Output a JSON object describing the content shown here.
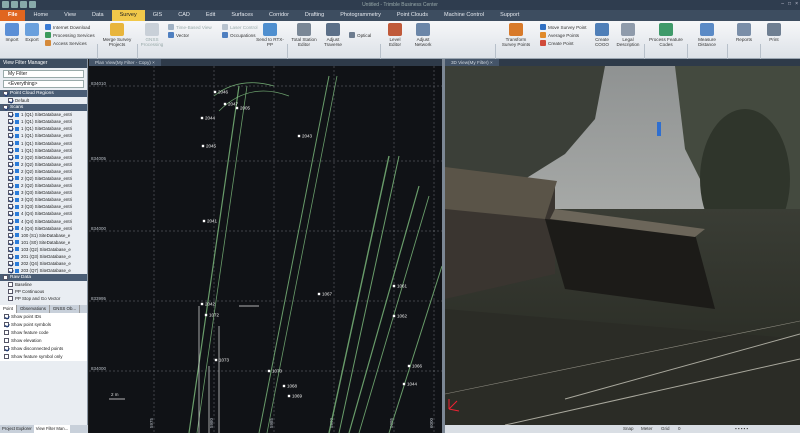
{
  "titlebar": {
    "window_title": "Untitled - Trimble Business Center"
  },
  "tabs": [
    "File",
    "Home",
    "View",
    "Data",
    "Survey",
    "GIS",
    "CAD",
    "Edit",
    "Surfaces",
    "Corridor",
    "Drafting",
    "Photogrammetry",
    "Point Clouds",
    "Machine Control",
    "Support"
  ],
  "active_tab": "Survey",
  "ribbon": {
    "import": "Import",
    "export": "Export",
    "internet_download": "Internet Download",
    "processing_services": "Processing Services",
    "access_services": "Access Services",
    "merge_survey_projects": "Merge Survey Projects",
    "gnss_processing": "GNSS Processing",
    "time_based_view": "Time-Based View",
    "vector": "Vector",
    "occupations": "Occupations",
    "laser_control": "Laser Control",
    "send_to": "Send to RTX-PP",
    "total_station_editor": "Total Station Editor",
    "adjust_traverse": "Adjust Traverse",
    "optical": "Optical",
    "level_editor": "Level Editor",
    "adjust_network": "Adjust Network",
    "transform_survey_points": "Transform Survey Points",
    "move_survey_point": "Move Survey Point",
    "average_points": "Average Points",
    "create_point": "Create Point",
    "create_cogo": "Create COGO",
    "legal_description": "Legal Description",
    "process_feature_codes": "Process Feature Codes",
    "measure_distance": "Measure Distance",
    "reports": "Reports",
    "print": "Print",
    "groups": {
      "import": "Import Export",
      "gnss": "GNSS",
      "optical": "Optical",
      "cogo": "COGO",
      "feature": "Feature",
      "measure": "Measure",
      "reports": "Reports",
      "print": "Print"
    }
  },
  "sidebar": {
    "title": "View Filter Manager",
    "filter_name": "My Filter",
    "everything": "<Everything>",
    "sections": {
      "point_cloud_regions": "Point Cloud Regions",
      "scans": "Scans",
      "raw_data": "Raw Data"
    },
    "regions": [
      "Default"
    ],
    "scans": [
      "1 (Q1) SiteDatabase_entri",
      "1 (Q1) SiteDatabase_entri",
      "1 (Q1) SiteDatabase_entri",
      "1 (Q1) SiteDatabase_entri",
      "1 (Q1) SiteDatabase_entri",
      "1 (Q1) SiteDatabase_entri",
      "2 (Q2) SiteDatabase_entri",
      "2 (Q2) SiteDatabase_entri",
      "2 (Q2) SiteDatabase_entri",
      "2 (Q2) SiteDatabase_entri",
      "2 (Q2) SiteDatabase_entri",
      "3 (Q3) SiteDatabase_entri",
      "3 (Q3) SiteDatabase_entri",
      "3 (Q3) SiteDatabase_entri",
      "4 (Q4) SiteDatabase_entri",
      "4 (Q4) SiteDatabase_entri",
      "4 (Q4) SiteDatabase_entri",
      "100 (S1) SiteDatabase_e",
      "101 (S0) SiteDatabase_e",
      "103 (Q2) SiteDatabase_e",
      "201 (Q3) SiteDatabase_e",
      "202 (Q4) SiteDatabase_e",
      "203 (Q7) SiteDatabase_e"
    ],
    "raw_data": [
      "Baseline",
      "PP Continuous",
      "PP Stop and Go Vector"
    ],
    "prop_tabs": [
      "Point",
      "Observations",
      "GNSS Ob..."
    ],
    "options": [
      {
        "label": "Show point IDs",
        "checked": true
      },
      {
        "label": "Show point symbols",
        "checked": true
      },
      {
        "label": "Show feature code",
        "checked": false
      },
      {
        "label": "Show elevation",
        "checked": false
      },
      {
        "label": "Show disconnected points",
        "checked": true
      },
      {
        "label": "Show feature symbol only",
        "checked": false
      }
    ],
    "footer_tabs": [
      "Project Explorer",
      "View Filter Man..."
    ]
  },
  "plan_view": {
    "tab": "Plan View(My Filter - Copy) ×",
    "northings": [
      "834010",
      "834005",
      "834000",
      "833995",
      "834000"
    ],
    "eastings": [
      "5975",
      "5980",
      "5985",
      "5990",
      "5995",
      "6000"
    ],
    "points": [
      "2044",
      "2045",
      "2046",
      "2047",
      "2005",
      "2043",
      "2041",
      "2042",
      "1067",
      "1072",
      "1073",
      "1061",
      "1070",
      "1068",
      "1069",
      "1062",
      "1066",
      "1044"
    ],
    "scale_label": "2 m"
  },
  "scene_view": {
    "tab": "3D View(My Filter) ×"
  },
  "status": {
    "snap": "Snap",
    "meter": "Meter",
    "grid": "Grid",
    "item_count": "0"
  }
}
